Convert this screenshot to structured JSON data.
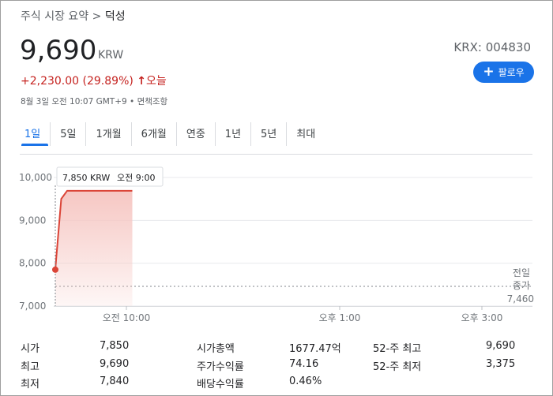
{
  "breadcrumb": {
    "parent": "주식 시장 요약",
    "separator": ">",
    "current": "덕성"
  },
  "quote": {
    "price": "9,690",
    "currency": "KRW",
    "exchange_ticker": "KRX: 004830",
    "change": "+2,230.00 (29.89%)",
    "change_arrow": "↑",
    "change_period": "오늘",
    "meta": "8월 3일 오전 10:07 GMT+9 • 면책조항"
  },
  "follow_button": {
    "icon": "plus-icon",
    "label": "팔로우"
  },
  "tabs": [
    {
      "label": "1일",
      "active": true
    },
    {
      "label": "5일"
    },
    {
      "label": "1개월"
    },
    {
      "label": "6개월"
    },
    {
      "label": "연중"
    },
    {
      "label": "1년"
    },
    {
      "label": "5년"
    },
    {
      "label": "최대"
    }
  ],
  "chart_data": {
    "type": "area",
    "y_ticks": [
      "10,000",
      "9,000",
      "8,000",
      "7,000"
    ],
    "y_tick_values": [
      10000,
      9000,
      8000,
      7000
    ],
    "ylim": [
      7000,
      10000
    ],
    "x_ticks": [
      "오전 10:00",
      "오후 1:00",
      "오후 3:00"
    ],
    "x_tick_minutes": [
      60,
      240,
      360
    ],
    "x_range_minutes": [
      0,
      390
    ],
    "series": [
      {
        "minutes": [
          0,
          5,
          10,
          20,
          30,
          65
        ],
        "values": [
          7850,
          9500,
          9690,
          9690,
          9690,
          9690
        ]
      }
    ],
    "previous_close": {
      "label_lines": [
        "전일",
        "종가"
      ],
      "value": 7460,
      "label_value": "7,460"
    },
    "tooltip": {
      "price": "7,850 KRW",
      "time": "오전 9:00"
    },
    "colors": {
      "line": "#db4437",
      "fill": "#f6c7c3",
      "grid": "#e8eaed"
    }
  },
  "stats": {
    "col1": [
      {
        "label": "시가",
        "value": "7,850"
      },
      {
        "label": "최고",
        "value": "9,690"
      },
      {
        "label": "최저",
        "value": "7,840"
      }
    ],
    "col2": [
      {
        "label": "시가총액",
        "value": "1677.47억"
      },
      {
        "label": "주가수익률",
        "value": "74.16"
      },
      {
        "label": "배당수익률",
        "value": "0.46%"
      }
    ],
    "col3": [
      {
        "label": "52-주 최고",
        "value": "9,690"
      },
      {
        "label": "52-주 최저",
        "value": "3,375"
      }
    ]
  }
}
